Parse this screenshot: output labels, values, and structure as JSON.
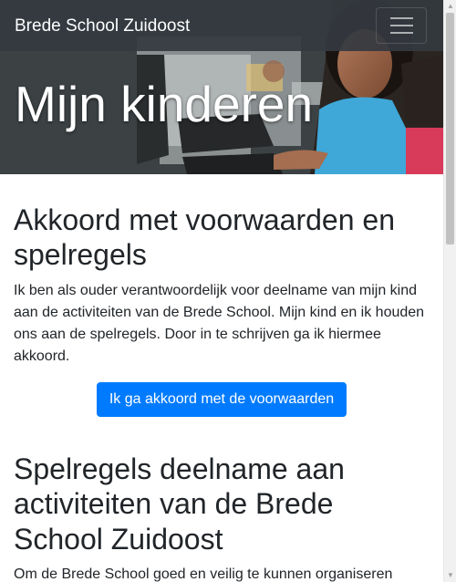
{
  "navbar": {
    "brand": "Brede School Zuidoost",
    "toggler_icon": "hamburger-icon"
  },
  "hero": {
    "title": "Mijn kinderen"
  },
  "section_terms": {
    "heading": "Akkoord met voorwaarden en spelregels",
    "text": "Ik ben als ouder verantwoordelijk voor deelname van mijn kind aan de activiteiten van de Brede School. Mijn kind en ik houden ons aan de spelregels. Door in te schrijven ga ik hiermee akkoord.",
    "button_label": "Ik ga akkoord met de voorwaarden"
  },
  "section_rules": {
    "heading": "Spelregels deelname aan activiteiten van de Brede School Zuidoost",
    "text": "Om de Brede School goed en veilig te kunnen organiseren"
  },
  "colors": {
    "navbar_bg": "#343a40",
    "primary": "#007bff",
    "text": "#212529"
  }
}
